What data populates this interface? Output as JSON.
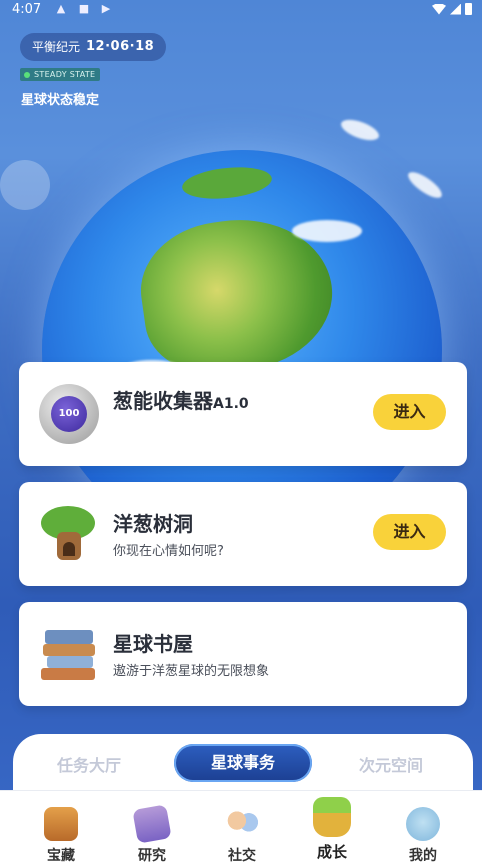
{
  "status_bar": {
    "time": "4:07"
  },
  "header": {
    "era_label": "平衡纪元",
    "era_date": "12·06·18",
    "state_tag": "STEADY STATE",
    "state_title": "星球状态稳定"
  },
  "cards": [
    {
      "title": "葱能收集器",
      "version": "A1.0",
      "subtitle": "",
      "button": "进入",
      "icon_text": "100"
    },
    {
      "title": "洋葱树洞",
      "subtitle": "你现在心情如何呢?",
      "button": "进入"
    },
    {
      "title": "星球书屋",
      "subtitle": "遨游于洋葱星球的无限想象"
    }
  ],
  "tabs": [
    {
      "label": "任务大厅"
    },
    {
      "label": "星球事务",
      "active": true
    },
    {
      "label": "次元空间"
    }
  ],
  "nav": [
    {
      "label": "宝藏",
      "icon": "treasure-chest-icon"
    },
    {
      "label": "研究",
      "icon": "research-book-icon"
    },
    {
      "label": "社交",
      "icon": "social-friends-icon"
    },
    {
      "label": "成长",
      "icon": "growth-plant-icon",
      "active": true
    },
    {
      "label": "我的",
      "icon": "profile-avatar-icon"
    }
  ],
  "colors": {
    "accent": "#f9d23a",
    "nav_active": "#3b6fd8",
    "tab_active": "#1c3f92"
  }
}
